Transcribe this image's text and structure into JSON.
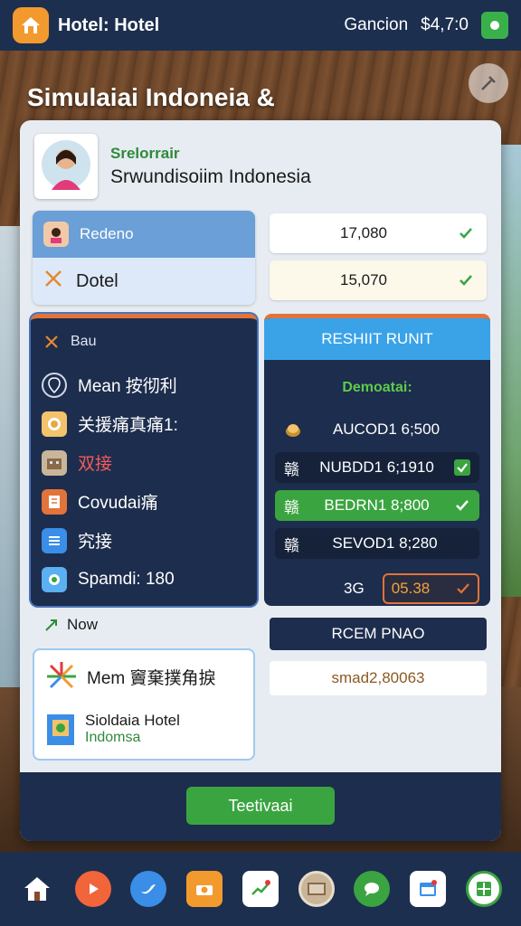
{
  "header": {
    "app_title": "Hotel: Hotel",
    "user_label": "Gancion",
    "balance": "$4,7:0"
  },
  "hero": {
    "title": "Simulaiai Indoneia &"
  },
  "profile": {
    "subtitle": "Srelorrair",
    "name": "Srwundisoiim Indonesia"
  },
  "summary": {
    "row1_label": "Redeno",
    "row2_label": "Dotel",
    "value1": "17,080",
    "value2": "15,070"
  },
  "menu": {
    "header": "Bau",
    "items": [
      {
        "label": "Mean 按彻利",
        "icon": "location-icon"
      },
      {
        "label": "关援痛真痛1:",
        "icon": "dish-icon"
      },
      {
        "label": "双接",
        "icon": "hotel-icon"
      },
      {
        "label": "Covudai痛",
        "icon": "book-icon"
      },
      {
        "label": "究接",
        "icon": "list-icon"
      },
      {
        "label": "Spamdi: 180",
        "icon": "map-icon"
      }
    ]
  },
  "result": {
    "header": "RESHIIT RUNIT",
    "subtitle": "Demoatai:",
    "rows": [
      {
        "prefix": "",
        "label": "AUCOD1 6;500",
        "state": "plain"
      },
      {
        "prefix": "赣",
        "label": "NUBDD1 6;1910",
        "state": "dark"
      },
      {
        "prefix": "赣",
        "label": "BEDRN1 8;800",
        "state": "green"
      },
      {
        "prefix": "赣",
        "label": "SEVOD1 8;280",
        "state": "dark"
      }
    ],
    "last_label": "3G",
    "last_value": "05.38"
  },
  "now": {
    "label": "Now",
    "news_title": "Mem 竇棄撲角捩",
    "news_sub1": "Sioldaia Hotel",
    "news_sub2": "Indomsa"
  },
  "room": {
    "button_label": "RCEM PNAO",
    "value": "smad2,80063"
  },
  "cta": {
    "label": "Teetivaai"
  },
  "bottom_nav": [
    {
      "name": "home-icon"
    },
    {
      "name": "play-icon"
    },
    {
      "name": "bird-icon"
    },
    {
      "name": "camera-icon"
    },
    {
      "name": "chart-icon"
    },
    {
      "name": "photo-icon"
    },
    {
      "name": "chat-icon"
    },
    {
      "name": "calendar-icon"
    },
    {
      "name": "grid-icon"
    }
  ],
  "colors": {
    "navy": "#1d2f4f",
    "green": "#3aa540",
    "blue": "#3aa3e8",
    "orange": "#e2733a"
  }
}
